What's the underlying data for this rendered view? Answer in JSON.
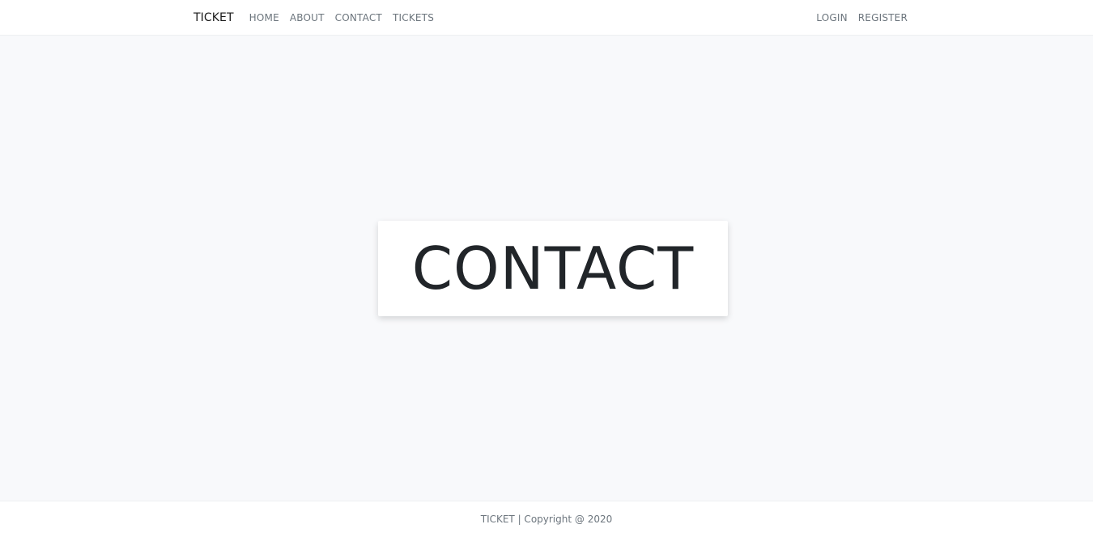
{
  "navbar": {
    "brand": "TICKET",
    "links": [
      "HOME",
      "ABOUT",
      "CONTACT",
      "TICKETS"
    ],
    "auth": [
      "LOGIN",
      "REGISTER"
    ]
  },
  "hero": {
    "title": "CONTACT"
  },
  "footer": {
    "text": "TICKET | Copyright @ 2020"
  },
  "colors": {
    "background": "#f8f9fb",
    "card": "#ffffff",
    "text": "#212529",
    "muted": "#6c757d"
  }
}
